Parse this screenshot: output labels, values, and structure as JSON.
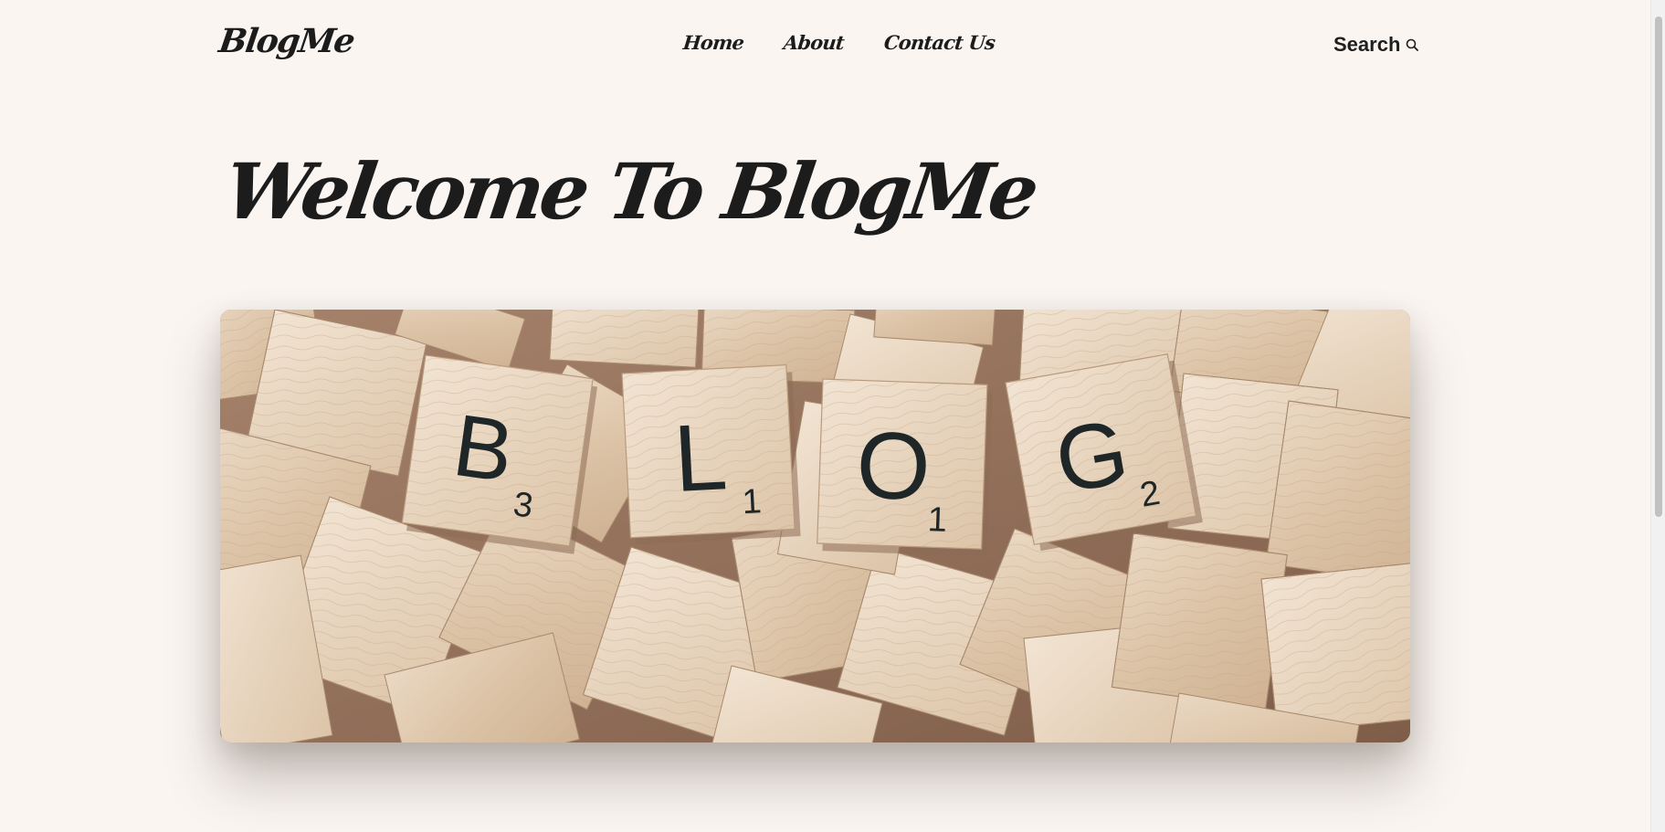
{
  "header": {
    "logo": "BlogMe",
    "nav": [
      {
        "label": "Home"
      },
      {
        "label": "About"
      },
      {
        "label": "Contact Us"
      }
    ],
    "search_label": "Search",
    "search_icon": "search-icon"
  },
  "hero": {
    "title": "Welcome To BlogMe",
    "image_alt_icon": "blog-tiles-image",
    "tiles": [
      {
        "letter": "B",
        "score": "3"
      },
      {
        "letter": "L",
        "score": "1"
      },
      {
        "letter": "O",
        "score": "1"
      },
      {
        "letter": "G",
        "score": "2"
      }
    ]
  },
  "colors": {
    "background": "#faf5f1",
    "text": "#1c1c1c",
    "tile": "#dcc3a6",
    "tile_shadow": "#b8977a",
    "board": "#9c7a64"
  }
}
